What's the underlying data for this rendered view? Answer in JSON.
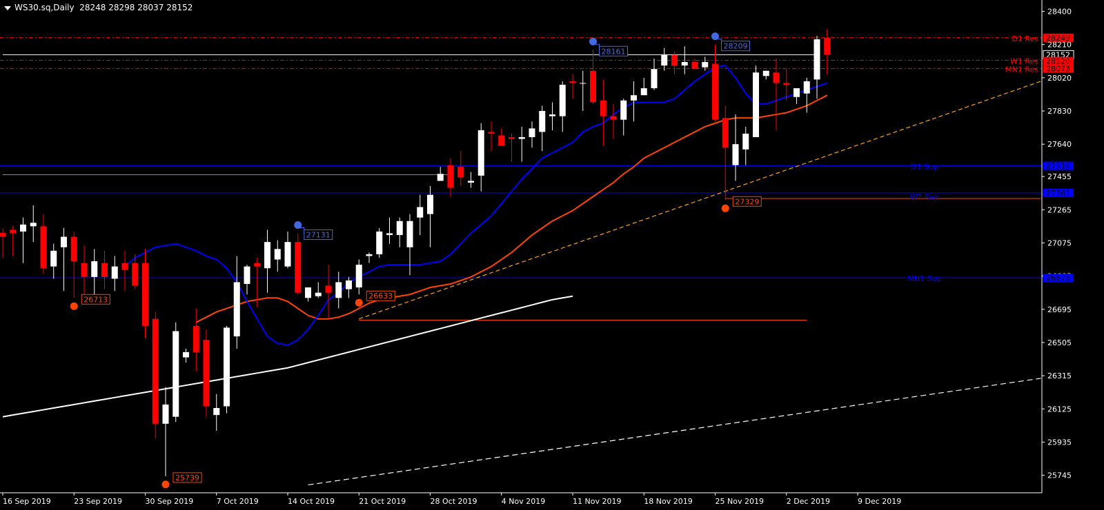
{
  "header": {
    "symbol": "WS30.sq,Daily",
    "ohlc": "28248 28298 28037 28152"
  },
  "colors": {
    "background": "#000000",
    "bull": "#ffffff",
    "bear": "#ff0000",
    "ma_fast": "#0000ff",
    "ma_mid": "#ff4500",
    "ma_slow": "#ffffff",
    "resistance": "#ff0000",
    "support": "#0000ff",
    "trendline": "#ffa500",
    "swing_high_marker": "#4169e1",
    "swing_low_marker": "#ff4500"
  },
  "chart_data": {
    "type": "candlestick",
    "y_axis": {
      "ylim": [
        25645,
        28465
      ],
      "ticks": [
        25745,
        25935,
        26125,
        26315,
        26505,
        26695,
        26885,
        27075,
        27265,
        27455,
        27640,
        27830,
        28020,
        28210,
        28400
      ]
    },
    "x_axis": {
      "labels": [
        "16 Sep 2019",
        "23 Sep 2019",
        "30 Sep 2019",
        "7 Oct 2019",
        "14 Oct 2019",
        "21 Oct 2019",
        "28 Oct 2019",
        "4 Nov 2019",
        "11 Nov 2019",
        "18 Nov 2019",
        "25 Nov 2019",
        "2 Dec 2019",
        "9 Dec 2019"
      ],
      "label_bar_index": [
        0,
        7,
        14,
        21,
        28,
        35,
        42,
        49,
        56,
        63,
        70,
        77,
        84
      ]
    },
    "candles": [
      [
        27133,
        27158,
        26990,
        27110
      ],
      [
        27150,
        27175,
        27000,
        27130
      ],
      [
        27140,
        27220,
        26960,
        27180
      ],
      [
        27170,
        27290,
        27080,
        27190
      ],
      [
        27170,
        27240,
        26900,
        26930
      ],
      [
        26940,
        27070,
        26870,
        27030
      ],
      [
        27050,
        27160,
        26800,
        27110
      ],
      [
        27110,
        27140,
        26760,
        26970
      ],
      [
        26960,
        27060,
        26770,
        26880
      ],
      [
        26880,
        27040,
        26760,
        26970
      ],
      [
        26960,
        27030,
        26810,
        26880
      ],
      [
        26870,
        27000,
        26800,
        26940
      ],
      [
        26960,
        27030,
        26800,
        26920
      ],
      [
        26960,
        27010,
        26810,
        26830
      ],
      [
        26960,
        27040,
        26530,
        26600
      ],
      [
        26640,
        26680,
        25955,
        26040
      ],
      [
        26040,
        26250,
        25740,
        26150
      ],
      [
        26080,
        26620,
        26050,
        26570
      ],
      [
        26420,
        26470,
        26390,
        26450
      ],
      [
        26600,
        26700,
        26340,
        26450
      ],
      [
        26520,
        26580,
        26080,
        26140
      ],
      [
        26090,
        26210,
        26000,
        26130
      ],
      [
        26140,
        26600,
        26100,
        26590
      ],
      [
        26540,
        27000,
        26470,
        26850
      ],
      [
        26840,
        26950,
        26780,
        26940
      ],
      [
        26960,
        26990,
        26710,
        26940
      ],
      [
        26930,
        27150,
        26790,
        27080
      ],
      [
        26980,
        27090,
        26910,
        27040
      ],
      [
        26940,
        27140,
        26930,
        27080
      ],
      [
        27080,
        27130,
        26780,
        26790
      ],
      [
        26760,
        26820,
        26740,
        26820
      ],
      [
        26770,
        26850,
        26760,
        26790
      ],
      [
        26830,
        26950,
        26640,
        26790
      ],
      [
        26760,
        26910,
        26700,
        26850
      ],
      [
        26810,
        26880,
        26760,
        26860
      ],
      [
        26820,
        26980,
        26780,
        26950
      ],
      [
        27000,
        27020,
        26960,
        27010
      ],
      [
        27010,
        27160,
        26990,
        27140
      ],
      [
        27120,
        27220,
        27070,
        27130
      ],
      [
        27120,
        27220,
        27050,
        27200
      ],
      [
        27050,
        27240,
        26890,
        27200
      ],
      [
        27220,
        27350,
        27120,
        27280
      ],
      [
        27240,
        27400,
        27050,
        27350
      ],
      [
        27430,
        27510,
        27430,
        27470
      ],
      [
        27520,
        27560,
        27340,
        27390
      ],
      [
        27510,
        27600,
        27400,
        27450
      ],
      [
        27420,
        27480,
        27390,
        27430
      ],
      [
        27460,
        27760,
        27370,
        27720
      ],
      [
        27710,
        27770,
        27600,
        27700
      ],
      [
        27690,
        27730,
        27630,
        27630
      ],
      [
        27680,
        27700,
        27540,
        27670
      ],
      [
        27670,
        27740,
        27540,
        27680
      ],
      [
        27680,
        27770,
        27620,
        27730
      ],
      [
        27710,
        27860,
        27600,
        27830
      ],
      [
        27800,
        27880,
        27720,
        27810
      ],
      [
        27800,
        28000,
        27710,
        27980
      ],
      [
        28000,
        28040,
        27900,
        27990
      ],
      [
        27990,
        28060,
        27830,
        27990
      ],
      [
        28060,
        28180,
        27870,
        27880
      ],
      [
        27890,
        28010,
        27630,
        27800
      ],
      [
        27800,
        27870,
        27670,
        27780
      ],
      [
        27780,
        27900,
        27690,
        27890
      ],
      [
        27890,
        28000,
        27770,
        27920
      ],
      [
        27920,
        28020,
        27940,
        27960
      ],
      [
        27960,
        28130,
        27950,
        28070
      ],
      [
        28090,
        28190,
        28060,
        28150
      ],
      [
        28150,
        28170,
        28040,
        28090
      ],
      [
        28090,
        28200,
        28040,
        28110
      ],
      [
        28110,
        28130,
        28090,
        28070
      ],
      [
        28080,
        28140,
        28060,
        28110
      ],
      [
        28100,
        28210,
        27770,
        27780
      ],
      [
        27790,
        27860,
        27320,
        27620
      ],
      [
        27520,
        27810,
        27430,
        27640
      ],
      [
        27610,
        27740,
        27520,
        27700
      ],
      [
        27680,
        28090,
        27680,
        28050
      ],
      [
        28030,
        28060,
        28010,
        28060
      ],
      [
        28050,
        28130,
        27720,
        27990
      ],
      [
        27990,
        28070,
        27890,
        27980
      ],
      [
        27910,
        27960,
        27870,
        27960
      ],
      [
        27930,
        28020,
        27820,
        28000
      ],
      [
        28010,
        28260,
        27900,
        28240
      ],
      [
        28248,
        28298,
        28037,
        28152
      ]
    ],
    "ma_fast": [
      26940,
      26990,
      27020,
      27050,
      27060,
      27070,
      27050,
      27030,
      27000,
      26980,
      26930,
      26850,
      26740,
      26640,
      26540,
      26500,
      26490,
      26520,
      26580,
      26660,
      26750,
      26790,
      26850,
      26880,
      26910,
      26940,
      26950,
      26950,
      26950,
      26950,
      26960,
      26970,
      27010,
      27070,
      27130,
      27180,
      27230,
      27300,
      27370,
      27440,
      27500,
      27560,
      27590,
      27620,
      27650,
      27710,
      27740,
      27760,
      27810,
      27850,
      27880,
      27880,
      27880,
      27880,
      27900,
      27950,
      28000,
      28040,
      28080,
      28090,
      28020,
      27930,
      27870,
      27870,
      27890,
      27910,
      27930,
      27950,
      27970,
      27990
    ],
    "ma_mid": [
      26620,
      26650,
      26680,
      26700,
      26720,
      26740,
      26750,
      26760,
      26760,
      26740,
      26700,
      26660,
      26640,
      26640,
      26650,
      26670,
      26700,
      26730,
      26750,
      26760,
      26770,
      26780,
      26800,
      26820,
      26830,
      26840,
      26860,
      26880,
      26910,
      26940,
      26980,
      27020,
      27070,
      27120,
      27160,
      27200,
      27230,
      27260,
      27300,
      27340,
      27380,
      27420,
      27470,
      27510,
      27560,
      27590,
      27620,
      27650,
      27680,
      27710,
      27740,
      27760,
      27780,
      27790,
      27790,
      27790,
      27800,
      27810,
      27820,
      27840,
      27860,
      27890,
      27920
    ],
    "ma_slow": [
      26080,
      26090,
      26100,
      26110,
      26120,
      26130,
      26140,
      26150,
      26160,
      26170,
      26180,
      26190,
      26200,
      26210,
      26220,
      26230,
      26240,
      26250,
      26260,
      26270,
      26280,
      26290,
      26300,
      26310,
      26320,
      26330,
      26340,
      26350,
      26360,
      26375,
      26390,
      26405,
      26420,
      26435,
      26450,
      26465,
      26480,
      26495,
      26510,
      26525,
      26540,
      26555,
      26570,
      26585,
      26600,
      26615,
      26630,
      26645,
      26660,
      26675,
      26690,
      26705,
      26720,
      26735,
      26750,
      26760,
      26770
    ],
    "levels": [
      {
        "name": "D1 Res",
        "value": 28249,
        "style": "dashdot",
        "color": "#ff0000",
        "label_color": "#ff0000"
      },
      {
        "name": "W1 Res",
        "value": 28120,
        "style": "dashdot",
        "color": "#ff0000",
        "label_color": "#ff0000"
      },
      {
        "name": "MN1 Res",
        "value": 28073,
        "style": "dashdot",
        "color": "#ff0000",
        "label_color": "#ff0000"
      },
      {
        "name": "D1 Sup",
        "value": 27516,
        "style": "solid",
        "color": "#0000ff",
        "label_color": "#0000ff"
      },
      {
        "name": "W1 Sup",
        "value": 27361,
        "style": "solid",
        "color": "#0000ff",
        "label_color": "#0000ff"
      },
      {
        "name": "MN1 Sup",
        "value": 26875,
        "style": "solid",
        "color": "#0000ff",
        "label_color": "#0000ff"
      }
    ],
    "price_tags": [
      {
        "text": "28249",
        "value": 28249,
        "bg": "#ff0000",
        "fg": "#000000"
      },
      {
        "text": "28152",
        "value": 28152,
        "bg": "#000000",
        "fg": "#ffffff",
        "border": "#ffffff"
      },
      {
        "text": "28120",
        "value": 28115,
        "bg": "#ff0000",
        "fg": "#000000"
      },
      {
        "text": "28073",
        "value": 28073,
        "bg": "#ff0000",
        "fg": "#000000"
      },
      {
        "text": "27516",
        "value": 27516,
        "bg": "#0000ff",
        "fg": "#000000"
      },
      {
        "text": "27361",
        "value": 27361,
        "bg": "#0000ff",
        "fg": "#000000"
      },
      {
        "text": "26875",
        "value": 26875,
        "bg": "#0000ff",
        "fg": "#000000"
      }
    ],
    "swing_highs": [
      {
        "text": "28161",
        "bar": 58
      },
      {
        "text": "28209",
        "bar": 70
      },
      {
        "text": "27131",
        "bar": 29
      }
    ],
    "swing_lows": [
      {
        "text": "26713",
        "bar": 7
      },
      {
        "text": "25739",
        "bar": 16
      },
      {
        "text": "26633",
        "bar": 35
      },
      {
        "text": "27329",
        "bar": 71
      }
    ],
    "trendline": {
      "from": [
        35,
        26640
      ],
      "to": [
        102,
        28000
      ],
      "color": "#ffa500"
    },
    "long_trendline": {
      "from": [
        30,
        25690
      ],
      "to": [
        102,
        26300
      ],
      "color": "#ffffff"
    },
    "flat_lines": [
      {
        "from_bar": 0,
        "to_bar": 44,
        "value": 27465,
        "color": "#6080ff"
      },
      {
        "from_bar": 0,
        "to_bar": 80,
        "value": 28152,
        "color": "#ffffff"
      },
      {
        "from_bar": 35,
        "to_bar": 79,
        "value": 26633,
        "color": "#ff4500"
      },
      {
        "from_bar": 71,
        "to_bar": 102,
        "value": 27329,
        "color": "#ff4500"
      }
    ]
  }
}
